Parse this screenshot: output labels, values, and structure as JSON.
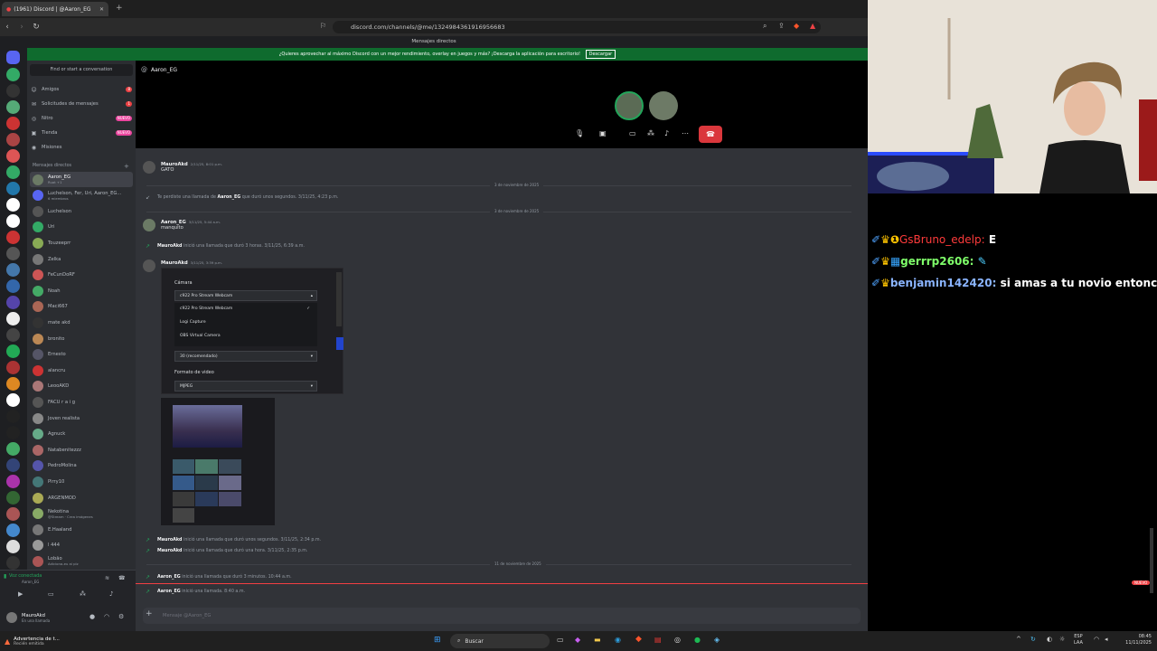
{
  "browser": {
    "tab_title": "(1961) Discord | @Aaron_EG",
    "url": "discord.com/channels/@me/1324984361916956683",
    "page_label": "Mensajes directos"
  },
  "banner": {
    "text": "¿Quieres aprovechar al máximo Discord con un mejor rendimiento, overlay en juegos y más? ¡Descarga la aplicación para escritorio!",
    "button": "Descargar"
  },
  "sidebar": {
    "find": "Find or start a conversation",
    "nav": [
      {
        "label": "Amigos",
        "badge": "8"
      },
      {
        "label": "Solicitudes de mensajes",
        "badge": "1"
      },
      {
        "label": "Nitro",
        "badge": "NUEVO"
      },
      {
        "label": "Tienda",
        "badge": "NUEVO"
      },
      {
        "label": "Misiones",
        "badge": ""
      }
    ],
    "dm_header": "Mensajes directos",
    "dms": [
      {
        "name": "Aaron_EG",
        "sub": "Ruat +1"
      },
      {
        "name": "Luchelson, Fer, Uri, Aaron_EG...",
        "sub": "6 miembros"
      },
      {
        "name": "Luchelson",
        "sub": ""
      },
      {
        "name": "Uri",
        "sub": ""
      },
      {
        "name": "Touzeeprr",
        "sub": ""
      },
      {
        "name": "Zelka",
        "sub": ""
      },
      {
        "name": "FeCunDoRF",
        "sub": ""
      },
      {
        "name": "Noah",
        "sub": ""
      },
      {
        "name": "Maci667",
        "sub": ""
      },
      {
        "name": "mate akd",
        "sub": ""
      },
      {
        "name": "bronito",
        "sub": ""
      },
      {
        "name": "Ernesto",
        "sub": ""
      },
      {
        "name": "alancru",
        "sub": ""
      },
      {
        "name": "LeooAKD",
        "sub": ""
      },
      {
        "name": "FACU r a i g",
        "sub": ""
      },
      {
        "name": "Joven realista",
        "sub": ""
      },
      {
        "name": "Agnuck",
        "sub": ""
      },
      {
        "name": "Natabenitezzz",
        "sub": ""
      },
      {
        "name": "PedroMolina",
        "sub": ""
      },
      {
        "name": "Pirry10",
        "sub": ""
      },
      {
        "name": "ARGENMOD",
        "sub": ""
      },
      {
        "name": "Nekotina",
        "sub": "@Stream · Crea imágenes"
      },
      {
        "name": "E.Haaland",
        "sub": ""
      },
      {
        "name": "l 444",
        "sub": ""
      },
      {
        "name": "Lobão",
        "sub": "Adiciona-eu ai plz"
      }
    ],
    "voice_status": "Voz conectada",
    "voice_channel": "Aaron_EG",
    "username": "MauroAkd",
    "user_status": "En una llamada"
  },
  "chat": {
    "header_name": "Aaron_EG",
    "input_placeholder": "Mensaje @Aaron_EG",
    "messages": [
      {
        "kind": "msg",
        "name": "MauroAkd",
        "time": "2/11/25, 8:01 p.m.",
        "text": "GATO"
      },
      {
        "kind": "divider",
        "text": "3 de noviembre de 2025"
      },
      {
        "kind": "sys",
        "text": "Te perdiste una llamada de",
        "who": "Aaron_EG",
        "tail": "que duró unos segundos. 3/11/25, 4:23 p.m."
      },
      {
        "kind": "divider",
        "text": "3 de noviembre de 2025"
      },
      {
        "kind": "msg",
        "name": "Aaron_EG",
        "time": "3/11/25, 5:44 a.m.",
        "text": "manquito"
      },
      {
        "kind": "sys",
        "who": "MauroAkd",
        "text": "",
        "tail": "inició una llamada que duró 3 horas. 3/11/25, 6:39 a.m."
      },
      {
        "kind": "msg",
        "name": "MauroAkd",
        "time": "3/11/25, 3:39 p.m.",
        "text": ""
      },
      {
        "kind": "sys",
        "who": "MauroAkd",
        "text": "",
        "tail": "inició una llamada que duró unos segundos. 3/11/25, 2:34 p.m."
      },
      {
        "kind": "sys",
        "who": "MauroAkd",
        "text": "",
        "tail": "inició una llamada que duró una hora. 3/11/25, 2:35 p.m."
      },
      {
        "kind": "divider",
        "text": "11 de noviembre de 2025"
      },
      {
        "kind": "sys",
        "who": "Aaron_EG",
        "text": "",
        "tail": "inició una llamada que duró 3 minutos. 10:44 a.m."
      },
      {
        "kind": "sys",
        "who": "Aaron_EG",
        "text": "",
        "tail": "inició una llamada. 8:40 a.m."
      }
    ],
    "camera_panel": {
      "title": "Cámara",
      "selected": "c922 Pro Stream Webcam",
      "options": [
        "c922 Pro Stream Webcam",
        "Logi Capture",
        "OBS Virtual Camera"
      ],
      "fps": "30 (recomendado)",
      "format_label": "Formato de video",
      "format": "MJPEG"
    },
    "new_badge": "NUEVO"
  },
  "stream_chat": [
    {
      "user": "GsBruno_edelp:",
      "msg": "E",
      "color": "#ff3b3b"
    },
    {
      "user": "gerrrp2606:",
      "msg": "",
      "color": "#7fff6a"
    },
    {
      "user": "benjamin142420:",
      "msg": "si amas a tu novio entonces ve",
      "color": "#8ab4ff"
    }
  ],
  "taskbar": {
    "notif_title": "Advertencia de t...",
    "notif_sub": "Recién emitida",
    "search": "Buscar",
    "lang": "ESP",
    "lang2": "LAA",
    "time": "08:45",
    "date": "11/11/2025"
  },
  "colors": {
    "discord_bg": "#313338",
    "sidebar": "#2b2d31",
    "accent_green": "#23a55a",
    "end_call": "#da373c"
  }
}
